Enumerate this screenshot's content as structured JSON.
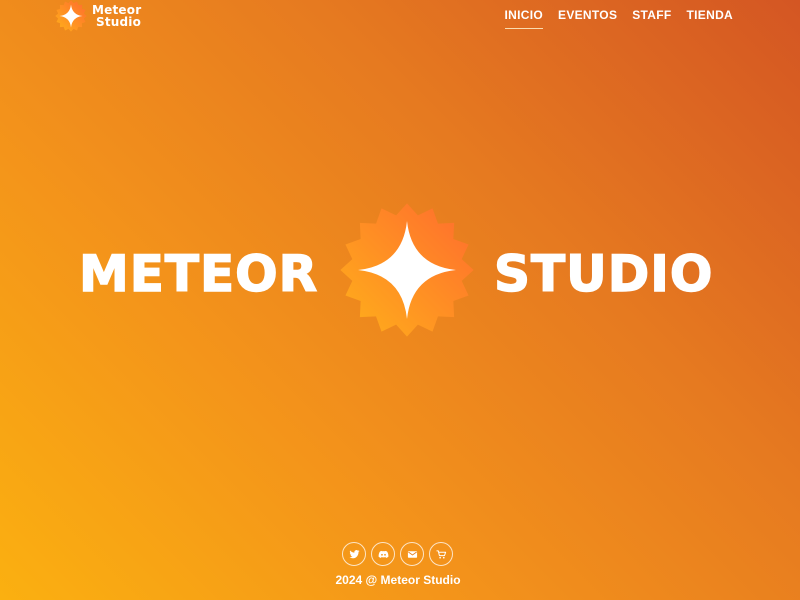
{
  "header": {
    "brand": {
      "line1": "Meteor",
      "line2": "Studio",
      "logo_icon": "four-point-star-badge-icon"
    },
    "nav": [
      {
        "label": "INICIO",
        "active": true
      },
      {
        "label": "EVENTOS",
        "active": false
      },
      {
        "label": "STAFF",
        "active": false
      },
      {
        "label": "TIENDA",
        "active": false
      }
    ]
  },
  "hero": {
    "word_left": "METEOR",
    "word_right": "STUDIO",
    "logo_icon": "four-point-star-badge-icon"
  },
  "footer": {
    "social": [
      {
        "name": "twitter",
        "icon": "twitter-icon"
      },
      {
        "name": "discord",
        "icon": "discord-icon"
      },
      {
        "name": "email",
        "icon": "mail-icon"
      },
      {
        "name": "store",
        "icon": "cart-icon"
      }
    ],
    "copyright": "2024 @ Meteor Studio"
  },
  "colors": {
    "background_start": "#fbb010",
    "background_end": "#d45623",
    "badge_light": "#ffb11a",
    "badge_dark": "#ff6b2e",
    "text": "#ffffff"
  }
}
